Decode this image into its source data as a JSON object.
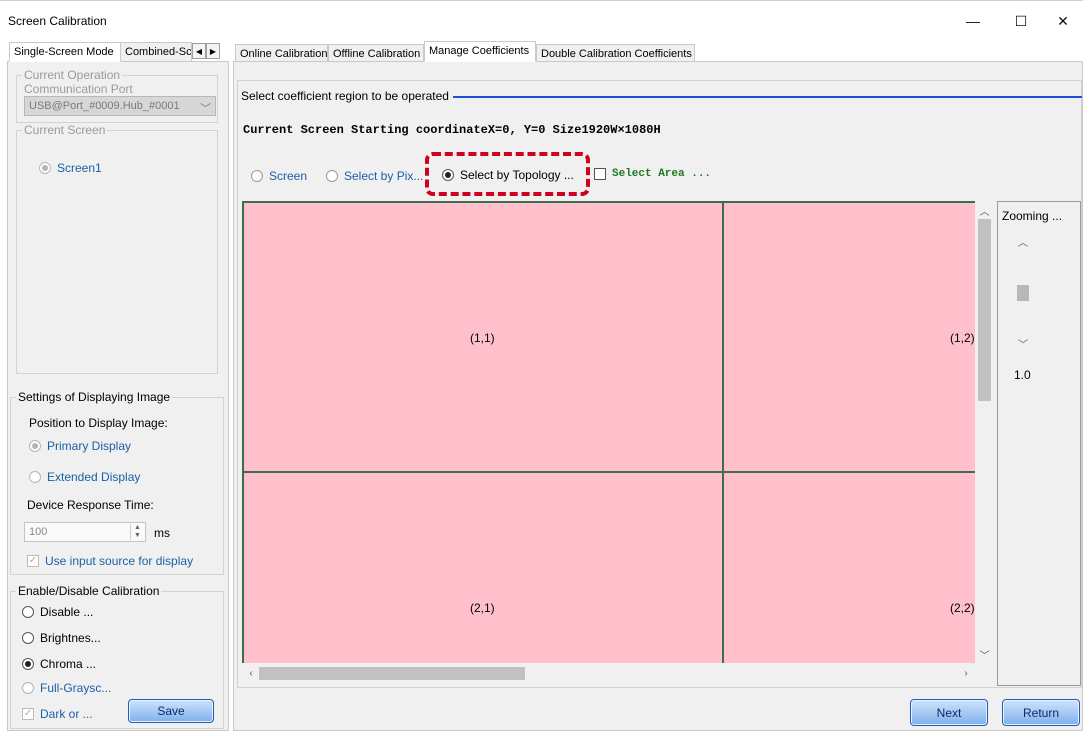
{
  "window": {
    "title": "Screen Calibration",
    "minimize_glyph": "—",
    "maximize_glyph": "☐",
    "close_glyph": "✕"
  },
  "left_tabs": [
    "Single-Screen Mode",
    "Combined-Sc"
  ],
  "left": {
    "operation_group": "Current Operation",
    "comm_port_label": "Communication Port",
    "comm_port_value": "USB@Port_#0009.Hub_#0001",
    "current_screen_group": "Current Screen",
    "screen_option": "Screen1",
    "display_settings_group": "Settings of Displaying Image",
    "position_label": "Position to Display Image:",
    "primary_display": "Primary Display",
    "extended_display": "Extended Display",
    "response_time_label": "Device Response Time:",
    "response_time_value": "100",
    "ms_label": "ms",
    "use_input_source": "Use input source for display",
    "calibration_group": "Enable/Disable Calibration",
    "cal_options": [
      "Disable ...",
      "Brightnes...",
      "Chroma ...",
      "Full-Graysc...",
      "Dark or ..."
    ],
    "save_button": "Save"
  },
  "right_tabs": [
    "Online Calibration",
    "Offline Calibration",
    "Manage Coefficients",
    "Double Calibration Coefficients"
  ],
  "right": {
    "region_label": "Select coefficient region to be operated",
    "screen_info": "Current Screen  Starting coordinateX=0, Y=0   Size1920W×1080H",
    "mode_screen": "Screen",
    "mode_pixel": "Select by Pix...",
    "mode_topology": "Select by Topology ...",
    "select_area": "Select Area ...",
    "cells": [
      "(1,1)",
      "(1,2)",
      "(2,1)",
      "(2,2)"
    ],
    "zoom_label": "Zooming ...",
    "zoom_value": "1.0",
    "next_button": "Next",
    "return_button": "Return"
  },
  "colors": {
    "cell_fill": "#ffc0cb",
    "cell_border": "#3f6b4f",
    "highlight_dash": "#d0021b",
    "accent_line": "#1f4fd8"
  }
}
